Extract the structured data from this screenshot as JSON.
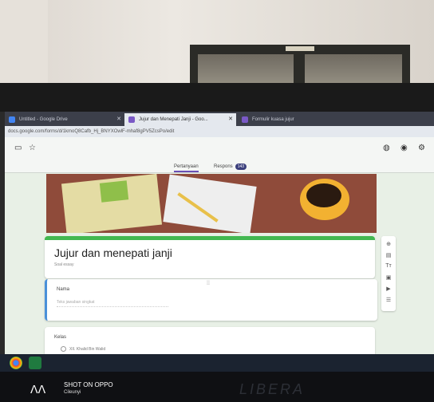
{
  "browser": {
    "tabs": [
      {
        "label": "Untitled - Google Drive",
        "active": false
      },
      {
        "label": "Jujur dan Menepati Janji - Goo...",
        "active": true
      },
      {
        "label": "Formulir kuasa jujur",
        "active": false
      }
    ],
    "url": "docs.google.com/forms/d/1kmoQ8Cafb_Hj_BNYXOwlF-mhaf8gPV5ZcsPo/edit"
  },
  "form_tabs": {
    "questions_label": "Pertanyaan",
    "responses_label": "Respons",
    "responses_count": "143"
  },
  "form": {
    "title": "Jujur dan menepati janji",
    "description": "Soal essay",
    "question1_label": "Nama",
    "question1_placeholder": "Teks jawaban singkat",
    "question2_label": "Kelas",
    "question2_option": "XII. Khalid Bin Walid"
  },
  "watermark": {
    "line1": "SHOT ON OPPO",
    "line2": "Cileunyi"
  },
  "monitor_brand": "LIBERA",
  "colors": {
    "accent": "#42b850",
    "question_border": "#4a90d9",
    "tab_underline": "#6a4fb5"
  }
}
